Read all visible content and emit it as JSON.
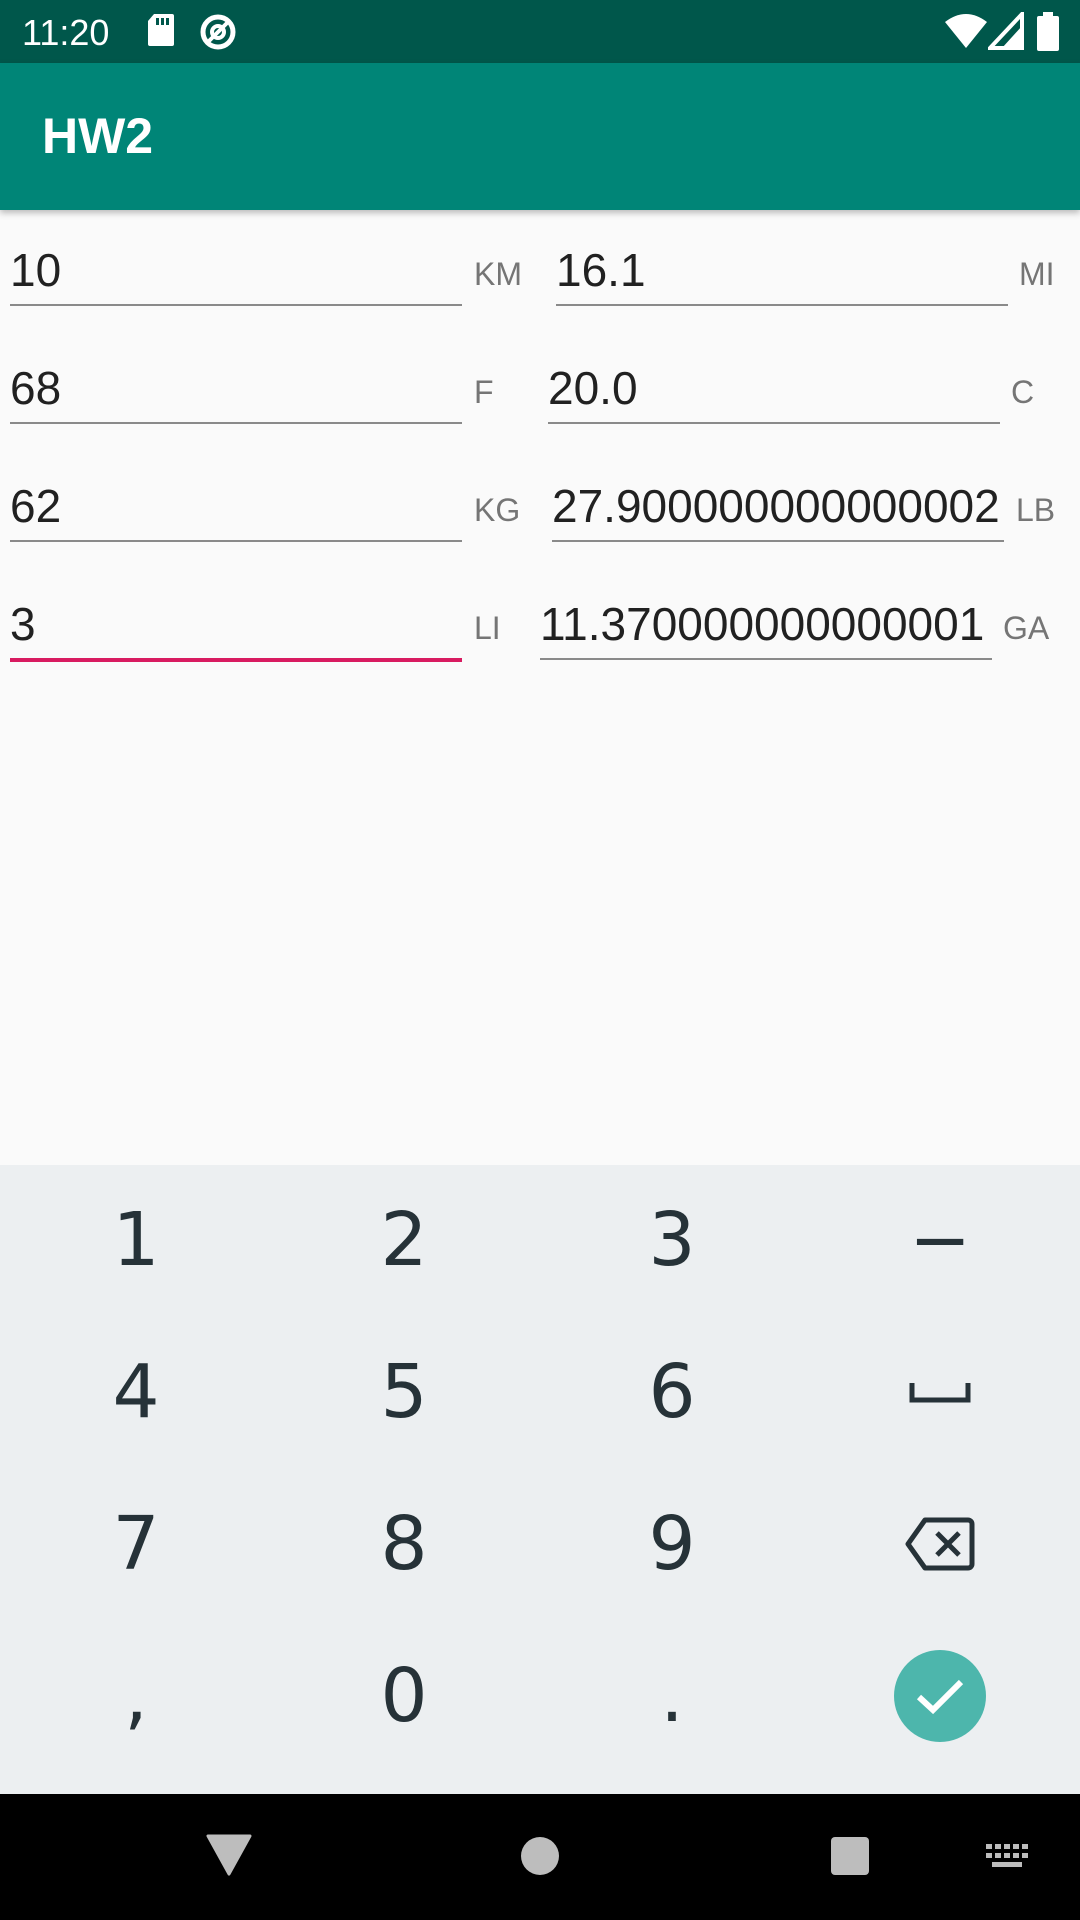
{
  "status_bar": {
    "time": "11:20",
    "left_icons": [
      "sd-card-icon",
      "data-saver-icon"
    ],
    "right_icons": [
      "wifi-icon",
      "signal-icon",
      "battery-icon"
    ]
  },
  "app_bar": {
    "title": "HW2"
  },
  "rows": [
    {
      "left_value": "10",
      "left_unit": "KM",
      "right_value": "16.1",
      "right_unit": "MI"
    },
    {
      "left_value": "68",
      "left_unit": "F",
      "right_value": "20.0",
      "right_unit": "C"
    },
    {
      "left_value": "62",
      "left_unit": "KG",
      "right_value": "27.900000000000002",
      "right_unit": "LB"
    },
    {
      "left_value": "3",
      "left_unit": "LI",
      "right_value": "11.370000000000001",
      "right_unit": "GA"
    }
  ],
  "focused_field": "rows.3.left_value",
  "keyboard": {
    "keys": [
      [
        "1",
        "2",
        "3",
        "−"
      ],
      [
        "4",
        "5",
        "6",
        "space-icon"
      ],
      [
        "7",
        "8",
        "9",
        "backspace-icon"
      ],
      [
        ",",
        "0",
        ".",
        "check-icon"
      ]
    ],
    "accent_color": "#4db6ac"
  },
  "colors": {
    "primary": "#008577",
    "primary_dark": "#00574b",
    "accent": "#d81b60"
  },
  "nav_bar": [
    "back-icon",
    "home-icon",
    "recents-icon",
    "keyboard-switch-icon"
  ]
}
